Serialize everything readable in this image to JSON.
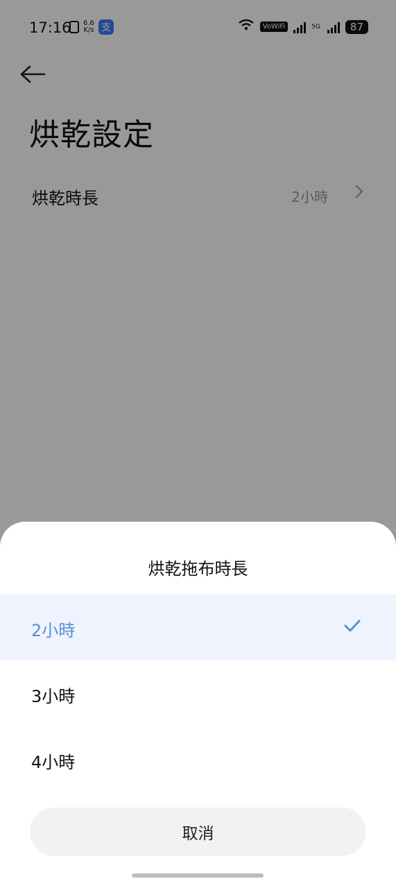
{
  "status_bar": {
    "time": "17:16",
    "speed_top": "6.6",
    "speed_bottom": "K/s",
    "vowifi": "VoWiFi",
    "network": "5G",
    "battery": "87"
  },
  "page": {
    "title": "烘乾設定",
    "setting": {
      "label": "烘乾時長",
      "value": "2小時"
    }
  },
  "sheet": {
    "title": "烘乾拖布時長",
    "options": [
      {
        "label": "2小時",
        "selected": true
      },
      {
        "label": "3小時",
        "selected": false
      },
      {
        "label": "4小時",
        "selected": false
      }
    ],
    "cancel_label": "取消"
  },
  "colors": {
    "accent": "#5b8ed6",
    "selected_bg": "#eef3fd",
    "overlay": "#000000"
  }
}
